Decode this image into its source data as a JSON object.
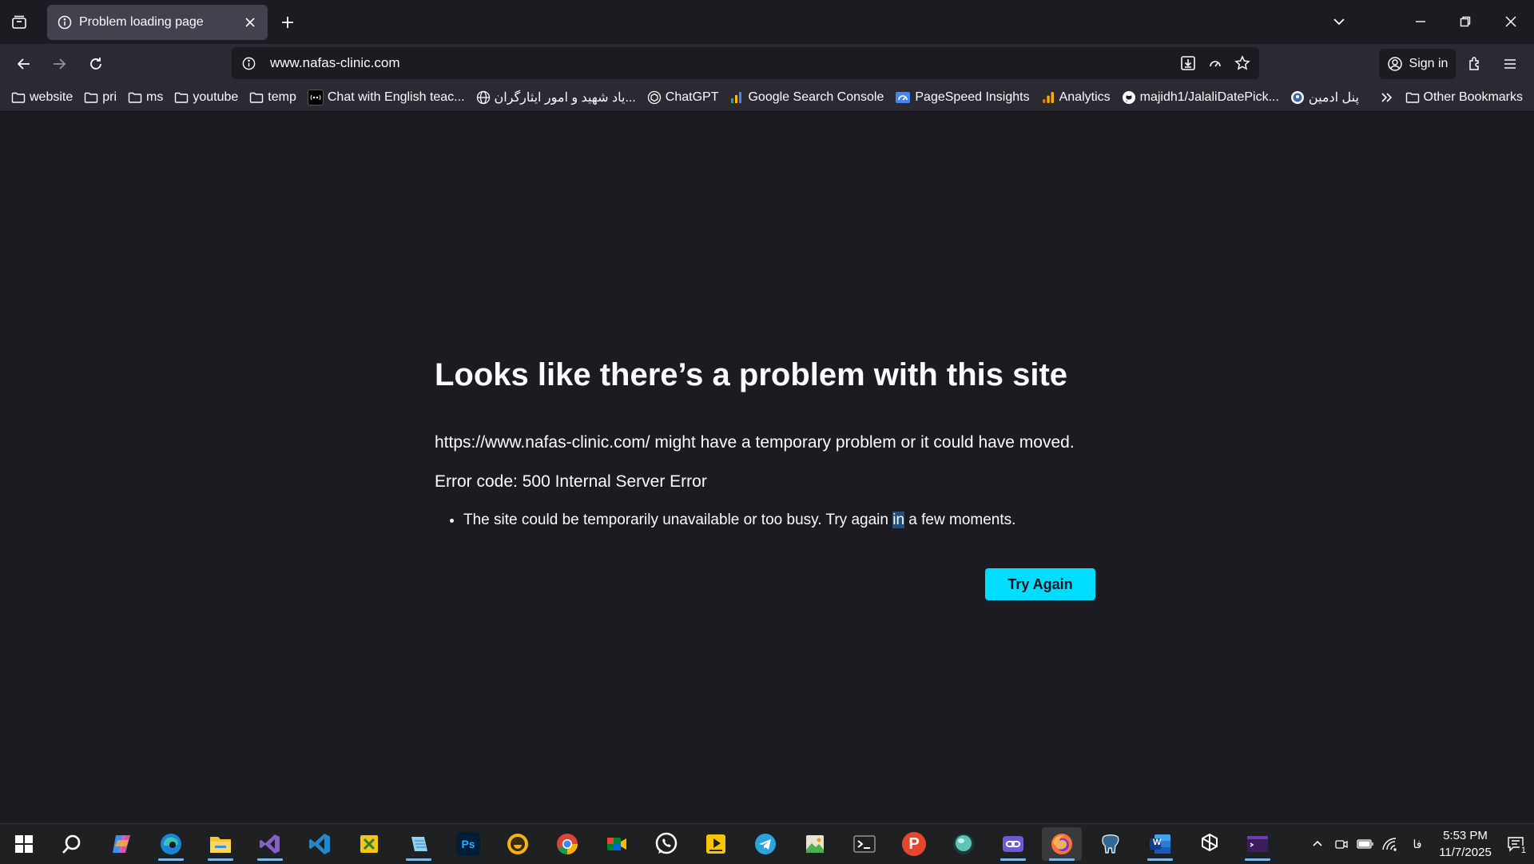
{
  "colors": {
    "accent_button": "#00ddff",
    "page_bg": "#1c1b22",
    "toolbar_bg": "#2b2a33",
    "tab_active_bg": "#42414d"
  },
  "tabbar": {
    "tab_title": "Problem loading page",
    "icons": [
      "tab-list-icon",
      "info-icon",
      "close-icon",
      "plus-icon",
      "chevron-down-icon",
      "minimize-icon",
      "restore-icon",
      "close-window-icon"
    ]
  },
  "navbar": {
    "url": "www.nafas-clinic.com",
    "sign_in": "Sign in",
    "icons": [
      "back-arrow-icon",
      "forward-arrow-icon",
      "reload-icon",
      "site-info-icon",
      "download-icon",
      "reader-icon",
      "star-icon",
      "account-icon",
      "extensions-icon",
      "menu-icon"
    ]
  },
  "bookmarks": {
    "items": [
      {
        "label": "website",
        "icon": "folder-icon"
      },
      {
        "label": "pri",
        "icon": "folder-icon"
      },
      {
        "label": "ms",
        "icon": "folder-icon"
      },
      {
        "label": "youtube",
        "icon": "folder-icon"
      },
      {
        "label": "temp",
        "icon": "folder-icon"
      },
      {
        "label": "Chat with English teac...",
        "icon": "chat-site-icon"
      },
      {
        "label": "...یاد شهید و امور ایثارگران",
        "icon": "globe-icon"
      },
      {
        "label": "ChatGPT",
        "icon": "chatgpt-icon"
      },
      {
        "label": "Google Search Console",
        "icon": "search-console-icon"
      },
      {
        "label": "PageSpeed Insights",
        "icon": "pagespeed-icon"
      },
      {
        "label": "Analytics",
        "icon": "analytics-icon"
      },
      {
        "label": "majidh1/JalaliDatePick...",
        "icon": "github-icon"
      },
      {
        "label": "پنل ادمین",
        "icon": "admin-panel-icon"
      }
    ],
    "other": "Other Bookmarks"
  },
  "error_page": {
    "title": "Looks like there’s a problem with this site",
    "description": "https://www.nafas-clinic.com/ might have a temporary problem or it could have moved.",
    "error_code": "Error code: 500 Internal Server Error",
    "bullet_before": "The site could be temporarily unavailable or too busy. Try again ",
    "bullet_selected": "in",
    "bullet_after": " a few moments.",
    "button": "Try Again"
  },
  "taskbar": {
    "apps": [
      "windows-start-icon",
      "search-icon",
      "copilot-icon",
      "edge-icon",
      "file-explorer-icon",
      "visual-studio-icon",
      "vscode-icon",
      "sticky-app-icon",
      "notepad-icon",
      "photoshop-icon",
      "emoji-app-icon",
      "chrome-icon",
      "meet-icon",
      "whatsapp-icon",
      "player-icon",
      "telegram-icon",
      "image-editor-icon",
      "terminal-icon",
      "postman-icon",
      "globe-app-icon",
      "link-app-icon",
      "firefox-icon",
      "postgresql-icon",
      "word-icon",
      "chatgpt-app-icon",
      "remote-terminal-icon"
    ],
    "ps_label": "Ps",
    "postman_label": "P",
    "word_label": "W",
    "lang": "فا",
    "time": "5:53 PM",
    "date": "11/7/2025",
    "notifications": "1"
  }
}
